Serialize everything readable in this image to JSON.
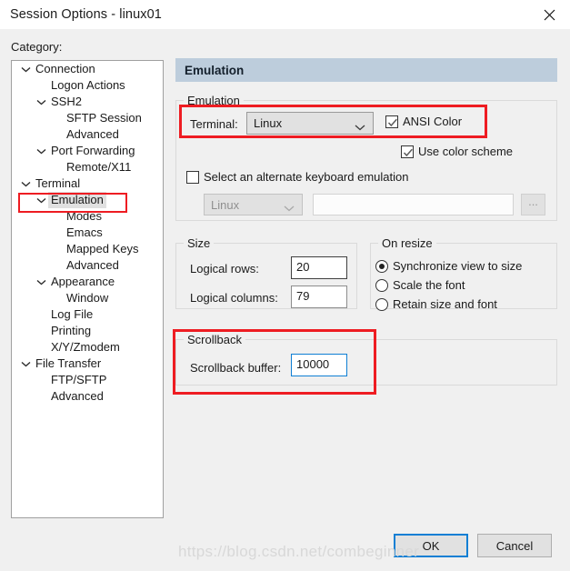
{
  "window": {
    "title": "Session Options - linux01",
    "close_icon": "close-icon"
  },
  "category": {
    "label": "Category:",
    "items": [
      {
        "label": "Connection",
        "level": 0,
        "expandable": true,
        "selected": false
      },
      {
        "label": "Logon Actions",
        "level": 1,
        "expandable": false,
        "selected": false
      },
      {
        "label": "SSH2",
        "level": 1,
        "expandable": true,
        "selected": false
      },
      {
        "label": "SFTP Session",
        "level": 2,
        "expandable": false,
        "selected": false
      },
      {
        "label": "Advanced",
        "level": 2,
        "expandable": false,
        "selected": false
      },
      {
        "label": "Port Forwarding",
        "level": 1,
        "expandable": true,
        "selected": false
      },
      {
        "label": "Remote/X11",
        "level": 2,
        "expandable": false,
        "selected": false
      },
      {
        "label": "Terminal",
        "level": 0,
        "expandable": true,
        "selected": false
      },
      {
        "label": "Emulation",
        "level": 1,
        "expandable": true,
        "selected": true
      },
      {
        "label": "Modes",
        "level": 2,
        "expandable": false,
        "selected": false
      },
      {
        "label": "Emacs",
        "level": 2,
        "expandable": false,
        "selected": false
      },
      {
        "label": "Mapped Keys",
        "level": 2,
        "expandable": false,
        "selected": false
      },
      {
        "label": "Advanced",
        "level": 2,
        "expandable": false,
        "selected": false
      },
      {
        "label": "Appearance",
        "level": 1,
        "expandable": true,
        "selected": false
      },
      {
        "label": "Window",
        "level": 2,
        "expandable": false,
        "selected": false
      },
      {
        "label": "Log File",
        "level": 1,
        "expandable": false,
        "selected": false
      },
      {
        "label": "Printing",
        "level": 1,
        "expandable": false,
        "selected": false
      },
      {
        "label": "X/Y/Zmodem",
        "level": 1,
        "expandable": false,
        "selected": false
      },
      {
        "label": "File Transfer",
        "level": 0,
        "expandable": true,
        "selected": false
      },
      {
        "label": "FTP/SFTP",
        "level": 1,
        "expandable": false,
        "selected": false
      },
      {
        "label": "Advanced",
        "level": 1,
        "expandable": false,
        "selected": false
      }
    ]
  },
  "pane": {
    "header": "Emulation"
  },
  "emulation_group": {
    "legend": "Emulation",
    "terminal_label": "Terminal:",
    "terminal_value": "Linux",
    "ansi_color_label": "ANSI Color",
    "ansi_color_checked": true,
    "use_color_scheme_label": "Use color scheme",
    "use_color_scheme_checked": true,
    "alt_keyboard_label": "Select an alternate keyboard emulation",
    "alt_keyboard_checked": false,
    "alt_keyboard_value": "Linux",
    "alt_keyboard_path": "",
    "browse_label": "..."
  },
  "size_group": {
    "legend": "Size",
    "rows_label": "Logical rows:",
    "rows_value": "20",
    "columns_label": "Logical columns:",
    "columns_value": "79"
  },
  "resize_group": {
    "legend": "On resize",
    "options": [
      {
        "label": "Synchronize view to size",
        "selected": true
      },
      {
        "label": "Scale the font",
        "selected": false
      },
      {
        "label": "Retain size and font",
        "selected": false
      }
    ]
  },
  "scrollback_group": {
    "legend": "Scrollback",
    "buffer_label": "Scrollback buffer:",
    "buffer_value": "10000"
  },
  "buttons": {
    "ok": "OK",
    "cancel": "Cancel"
  },
  "watermark": "https://blog.csdn.net/combeginner",
  "colors": {
    "pane_header_bg": "#bdcddc",
    "annotation_red": "#ee1c22",
    "focus_blue": "#0f7fd4",
    "window_bg": "#f0f0f0",
    "control_bg": "#e1e1e1"
  }
}
